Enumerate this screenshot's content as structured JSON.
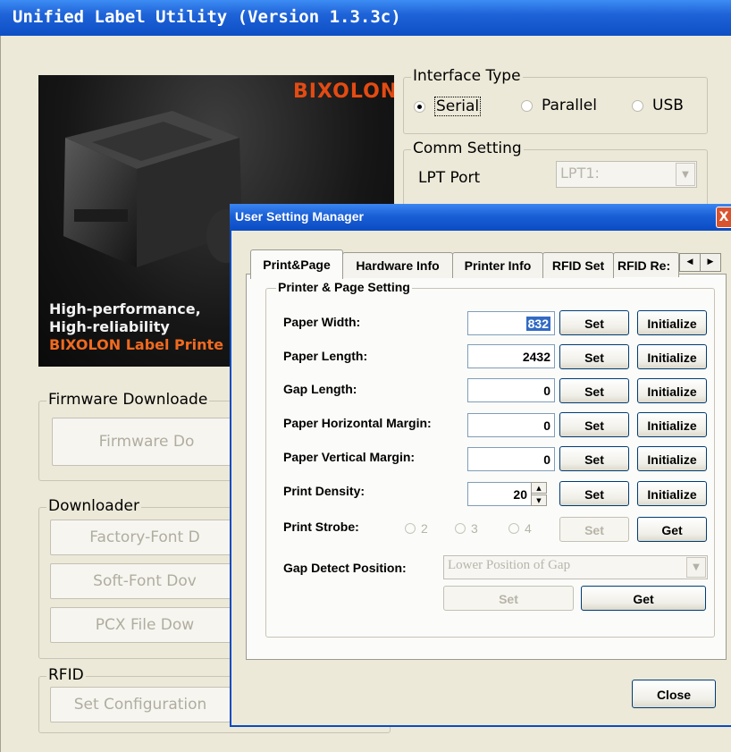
{
  "main": {
    "title": "Unified Label Utility (Version 1.3.3c)",
    "promo": {
      "brand": "BIXOLON",
      "line1": "High-performance,",
      "line2": "High-reliability",
      "line3": "BIXOLON Label Printe"
    },
    "interface": {
      "legend": "Interface Type",
      "options": [
        "Serial",
        "Parallel",
        "USB"
      ],
      "selected": "Serial"
    },
    "comm": {
      "legend": "Comm Setting",
      "lpt_label": "LPT Port",
      "lpt_value": "LPT1:"
    },
    "firmware": {
      "legend": "Firmware Downloade",
      "button": "Firmware Do"
    },
    "downloader": {
      "legend": "Downloader",
      "buttons": [
        "Factory-Font D",
        "Soft-Font Dov",
        "PCX File Dow"
      ]
    },
    "rfid": {
      "legend": "RFID",
      "button": "Set Configuration"
    }
  },
  "dialog": {
    "title": "User Setting Manager",
    "close_glyph": "X",
    "tabs": [
      "Print&Page",
      "Hardware Info",
      "Printer Info",
      "RFID Set",
      "RFID Re:"
    ],
    "group_legend": "Printer & Page Setting",
    "rows": [
      {
        "label": "Paper Width:",
        "value": "832"
      },
      {
        "label": "Paper Length:",
        "value": "2432"
      },
      {
        "label": "Gap Length:",
        "value": "0"
      },
      {
        "label": "Paper Horizontal Margin:",
        "value": "0"
      },
      {
        "label": "Paper Vertical Margin:",
        "value": "0"
      },
      {
        "label": "Print Density:",
        "value": "20"
      }
    ],
    "set_label": "Set",
    "init_label": "Initialize",
    "strobe": {
      "label": "Print Strobe:",
      "options": [
        "2",
        "3",
        "4"
      ],
      "set": "Set",
      "get": "Get"
    },
    "gap_detect": {
      "label": "Gap Detect Position:",
      "value": "Lower Position of Gap",
      "set": "Set",
      "get": "Get"
    },
    "close_button": "Close"
  }
}
